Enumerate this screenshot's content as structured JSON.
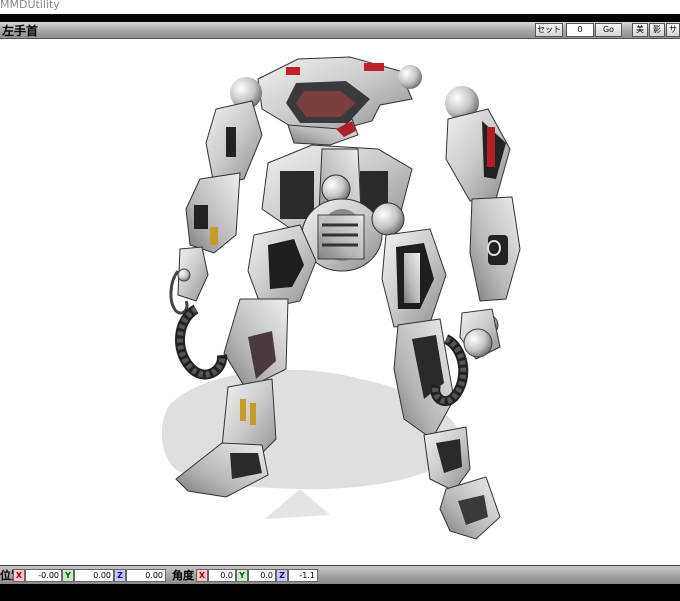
{
  "app": {
    "title": "MMDUtility"
  },
  "header": {
    "bone_name": "左手首",
    "set_button": "セット",
    "frame_value": "0",
    "go_button": "Go",
    "btn_a": "美",
    "btn_b": "影",
    "btn_c": "サ"
  },
  "status": {
    "position_label": "位置",
    "rotation_label": "角度",
    "x": "X",
    "y": "Y",
    "z": "Z",
    "pos_x": "-0.00",
    "pos_y": "0.00",
    "pos_z": "0.00",
    "rot_x": "0.0",
    "rot_y": "0.0",
    "rot_z": "-1.1"
  },
  "colors": {
    "axis_x": "#b00000",
    "axis_y": "#006000",
    "axis_z": "#0000a0",
    "viewport_bg": "#ffffff"
  }
}
